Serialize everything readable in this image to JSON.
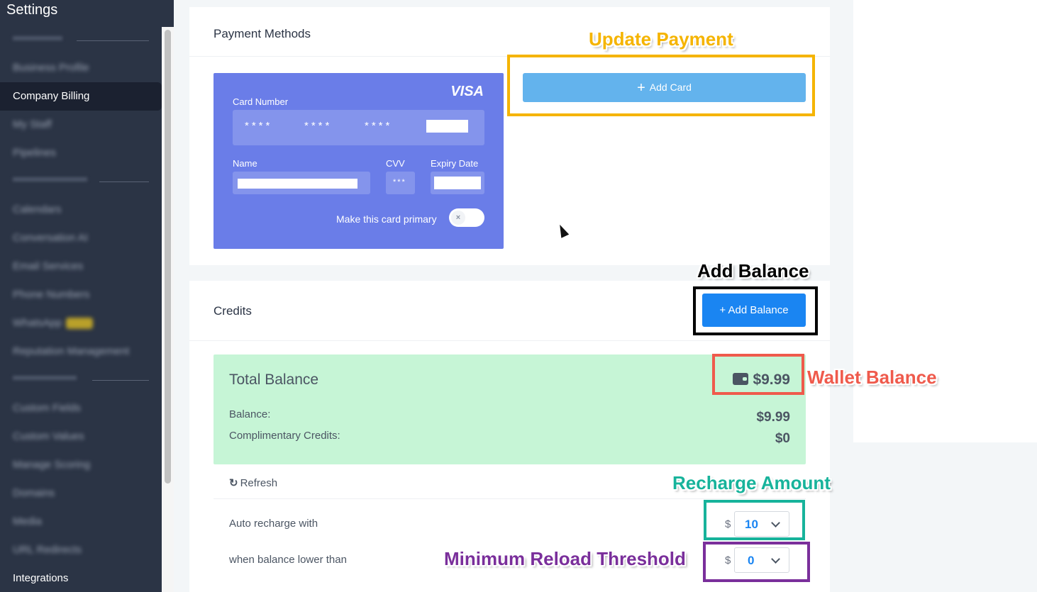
{
  "sidebar": {
    "title": "Settings",
    "items": [
      {
        "label": "My Business",
        "blurred": true
      },
      {
        "label": "Business Profile",
        "blurred": true
      },
      {
        "label": "Company Billing",
        "blurred": false,
        "active": true
      },
      {
        "label": "My Staff",
        "blurred": true
      },
      {
        "label": "Pipelines",
        "blurred": true
      },
      {
        "label": "Calendars",
        "blurred": true
      },
      {
        "label": "Conversation AI",
        "blurred": true
      },
      {
        "label": "Email Services",
        "blurred": true
      },
      {
        "label": "Phone Numbers",
        "blurred": true
      },
      {
        "label": "WhatsApp",
        "blurred": true
      },
      {
        "label": "Reputation Management",
        "blurred": true
      },
      {
        "label": "Custom Fields",
        "blurred": true
      },
      {
        "label": "Custom Values",
        "blurred": true
      },
      {
        "label": "Manage Scoring",
        "blurred": true
      },
      {
        "label": "Domains",
        "blurred": true
      },
      {
        "label": "Media",
        "blurred": true
      },
      {
        "label": "URL Redirects",
        "blurred": true
      },
      {
        "label": "Integrations",
        "blurred": false
      }
    ]
  },
  "payment": {
    "title": "Payment Methods",
    "card": {
      "brand": "VISA",
      "number_label": "Card Number",
      "mask_groups": [
        "****",
        "****",
        "****"
      ],
      "name_label": "Name",
      "cvv_label": "CVV",
      "cvv_value": "***",
      "expiry_label": "Expiry Date",
      "primary_label": "Make this card primary",
      "primary_toggle": "×"
    },
    "add_card_label": "Add Card"
  },
  "credits": {
    "title": "Credits",
    "add_balance_label": "+ Add Balance",
    "total_label": "Total Balance",
    "total_value": "$9.99",
    "balance_label": "Balance:",
    "balance_value": "$9.99",
    "complimentary_label": "Complimentary Credits:",
    "complimentary_value": "$0",
    "refresh_label": "Refresh",
    "auto_recharge_label": "Auto recharge with",
    "auto_recharge_currency": "$",
    "auto_recharge_value": "10",
    "threshold_label": "when balance lower than",
    "threshold_currency": "$",
    "threshold_value": "0"
  },
  "annotations": {
    "update_payment": {
      "label": "Update Payment",
      "color": "#f5b400"
    },
    "add_balance": {
      "label": "Add Balance",
      "color": "#000000"
    },
    "wallet_balance": {
      "label": "Wallet Balance",
      "color": "#ef5a4c"
    },
    "recharge_amount": {
      "label": "Recharge Amount",
      "color": "#17b39b"
    },
    "min_threshold": {
      "label": "Minimum Reload Threshold",
      "color": "#7a2f9b"
    }
  }
}
